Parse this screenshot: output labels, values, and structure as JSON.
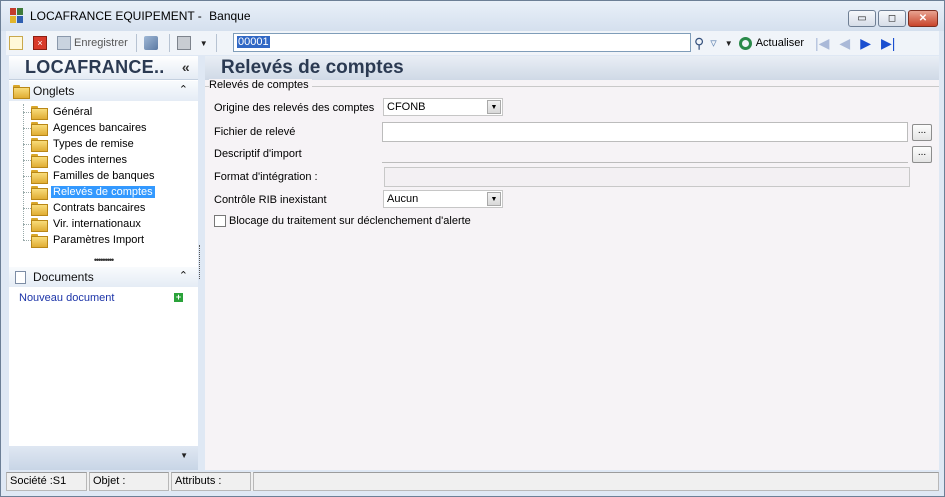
{
  "window": {
    "title": "LOCAFRANCE EQUIPEMENT - ",
    "subtitle": "Banque",
    "buttons": {
      "minimize": "▭",
      "restore": "◻",
      "close": "✕"
    }
  },
  "toolbar": {
    "save_label": "Enregistrer",
    "record_value": "00001",
    "refresh_label": "Actualiser"
  },
  "left_panel": {
    "header": "LOCAFRANCE..",
    "collapse_glyph": "«",
    "onglets_title": "Onglets",
    "onglets_chevron": "⌃",
    "items": [
      {
        "label": "Général",
        "selected": false
      },
      {
        "label": "Agences bancaires",
        "selected": false
      },
      {
        "label": "Types de remise",
        "selected": false
      },
      {
        "label": "Codes internes",
        "selected": false
      },
      {
        "label": "Familles de banques",
        "selected": false
      },
      {
        "label": "Relevés de comptes",
        "selected": true
      },
      {
        "label": "Contrats bancaires",
        "selected": false
      },
      {
        "label": "Vir. internationaux",
        "selected": false
      },
      {
        "label": "Paramètres Import",
        "selected": false
      }
    ],
    "grip": "•••••••••",
    "documents_title": "Documents",
    "documents_chevron": "⌃",
    "new_document": "Nouveau document",
    "plus": "+",
    "bottom_arrow": "▼"
  },
  "main": {
    "title": "Relevés de comptes",
    "group_title": "Relevés de comptes",
    "origine_label": "Origine des relevés des comptes",
    "origine_value": "CFONB",
    "fichier_label": "Fichier de relevé",
    "descriptif_label": "Descriptif d'import",
    "format_label": "Format d'intégration :",
    "controle_label": "Contrôle RIB inexistant",
    "controle_value": "Aucun",
    "blocage_label": "Blocage du traitement sur déclenchement d'alerte",
    "ellipsis": "..."
  },
  "status": {
    "societe": "Société :S1",
    "objet": "Objet :",
    "attributs": "Attributs :"
  },
  "colors": {
    "selection": "#3399ff",
    "header_text": "#2b3a52",
    "link": "#1c34a8"
  }
}
